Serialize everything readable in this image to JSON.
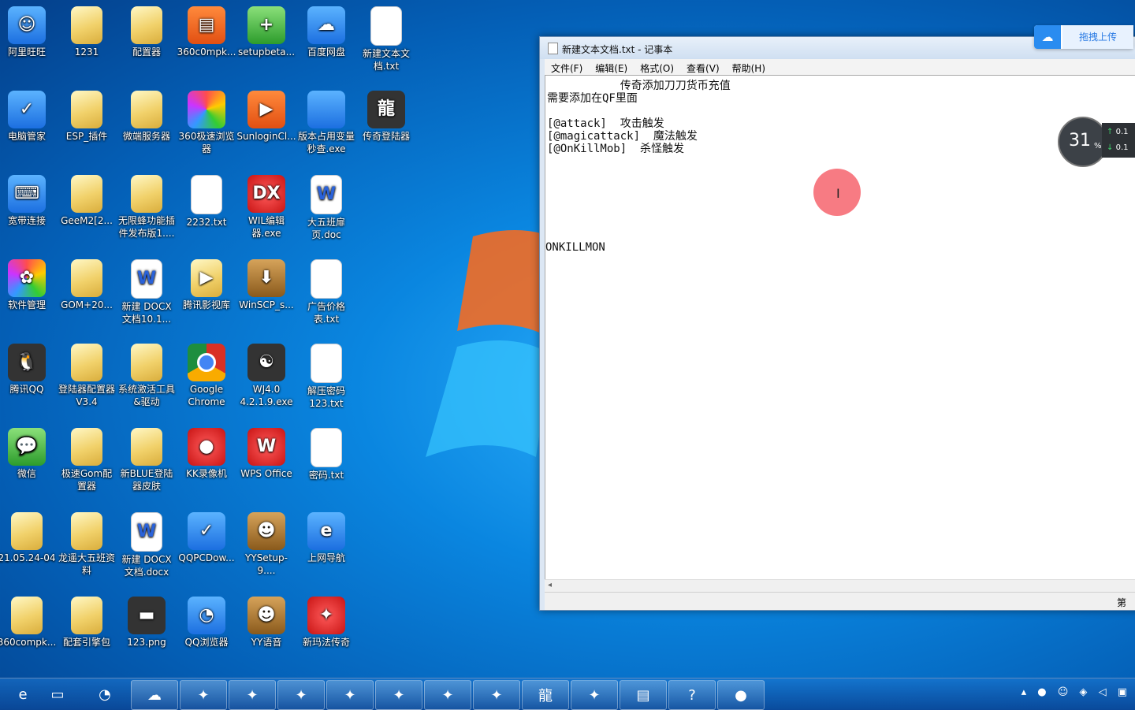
{
  "desktop": {
    "icons": [
      {
        "label": "阿里旺旺",
        "sym": "☺"
      },
      {
        "label": "1231",
        "sym": ""
      },
      {
        "label": "配置器",
        "sym": ""
      },
      {
        "label": "360c0mpk...",
        "sym": "▤"
      },
      {
        "label": "setupbeta...",
        "sym": "+"
      },
      {
        "label": "百度网盘",
        "sym": "☁"
      },
      {
        "label": "新建文本文档.txt",
        "sym": ""
      },
      {
        "label": "电脑管家",
        "sym": "✓"
      },
      {
        "label": "ESP_插件",
        "sym": ""
      },
      {
        "label": "微端服务器",
        "sym": ""
      },
      {
        "label": "360极速浏览器",
        "sym": ""
      },
      {
        "label": "SunloginCl...",
        "sym": "▶"
      },
      {
        "label": "版本占用变量秒查.exe",
        "sym": ""
      },
      {
        "label": "传奇登陆器",
        "sym": "龍"
      },
      {
        "label": "宽带连接",
        "sym": "⌨"
      },
      {
        "label": "GeeM2[2...",
        "sym": ""
      },
      {
        "label": "无限蜂功能插件发布版1....",
        "sym": ""
      },
      {
        "label": "2232.txt",
        "sym": ""
      },
      {
        "label": "WIL编辑器.exe",
        "sym": "DX"
      },
      {
        "label": "大五班扉页.doc",
        "sym": "W"
      },
      {
        "label": "软件管理",
        "sym": "✿"
      },
      {
        "label": "GOM+20...",
        "sym": ""
      },
      {
        "label": "新建 DOCX 文档10.1...",
        "sym": "W"
      },
      {
        "label": "腾讯影视库",
        "sym": "▶"
      },
      {
        "label": "WinSCP_s...",
        "sym": "⬇"
      },
      {
        "label": "广告价格表.txt",
        "sym": ""
      },
      {
        "label": "腾讯QQ",
        "sym": "🐧"
      },
      {
        "label": "登陆器配置器V3.4",
        "sym": ""
      },
      {
        "label": "系统激活工具&驱动",
        "sym": ""
      },
      {
        "label": "Google Chrome",
        "sym": ""
      },
      {
        "label": "WJ4.0 4.2.1.9.exe",
        "sym": "☯"
      },
      {
        "label": "解压密码123.txt",
        "sym": ""
      },
      {
        "label": "微信",
        "sym": "💬"
      },
      {
        "label": "极速Gom配置器",
        "sym": ""
      },
      {
        "label": "新BLUE登陆器皮肤",
        "sym": ""
      },
      {
        "label": "KK录像机",
        "sym": "●"
      },
      {
        "label": "WPS Office",
        "sym": "W"
      },
      {
        "label": "密码.txt",
        "sym": ""
      },
      {
        "label": "21.05.24-04",
        "sym": ""
      },
      {
        "label": "龙遥大五班资料",
        "sym": ""
      },
      {
        "label": "新建 DOCX 文档.docx",
        "sym": "W"
      },
      {
        "label": "QQPCDow...",
        "sym": "✓"
      },
      {
        "label": "YYSetup-9....",
        "sym": "☻"
      },
      {
        "label": "上网导航",
        "sym": "e"
      },
      {
        "label": "360compk...",
        "sym": ""
      },
      {
        "label": "配套引擎包",
        "sym": ""
      },
      {
        "label": "123.png",
        "sym": "▬"
      },
      {
        "label": "QQ浏览器",
        "sym": "◔"
      },
      {
        "label": "YY语音",
        "sym": "☻"
      },
      {
        "label": "新玛法传奇",
        "sym": "✦"
      }
    ]
  },
  "notepad": {
    "title": "新建文本文档.txt - 记事本",
    "menu": [
      "文件(F)",
      "编辑(E)",
      "格式(O)",
      "查看(V)",
      "帮助(H)"
    ],
    "lines": [
      "           传奇添加刀刀货币充值",
      "需要添加在QF里面",
      "",
      "[@attack]  攻击触发",
      "[@magicattack]  魔法触发",
      "[@OnKillMob]  杀怪触发",
      "ONKILLMON"
    ],
    "status": "第"
  },
  "upload_button": {
    "label": "拖拽上传"
  },
  "speed_widget": {
    "percent": "31",
    "unit": "%",
    "up": "0.1",
    "down": "0.1"
  },
  "taskbar": {
    "items": [
      "ie",
      "explorer",
      "qq-browser",
      "baidu",
      "app",
      "app",
      "app",
      "app",
      "app",
      "app",
      "app",
      "dragon",
      "app",
      "doc",
      "help",
      "kk"
    ]
  }
}
